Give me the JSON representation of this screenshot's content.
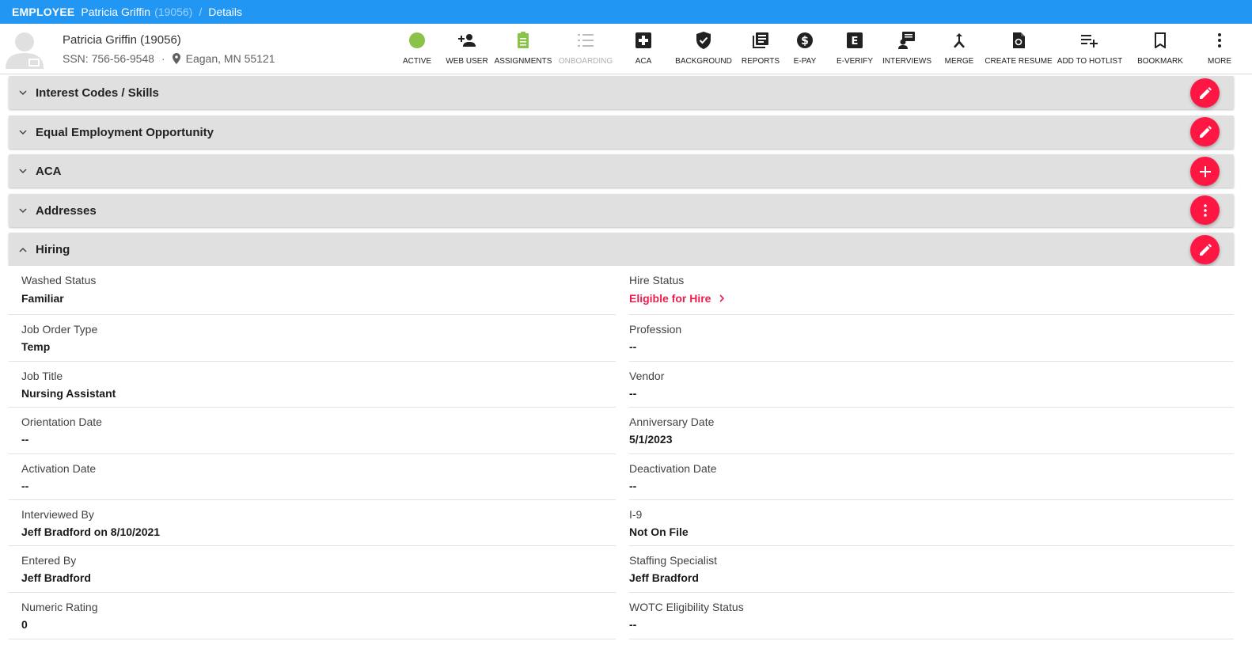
{
  "breadcrumb": {
    "module": "EMPLOYEE",
    "name": "Patricia Griffin",
    "id": "(19056)",
    "separator": "/",
    "current": "Details"
  },
  "employee": {
    "name": "Patricia Griffin (19056)",
    "ssn": "SSN: 756-56-9548",
    "dot": "·",
    "location": "Eagan, MN 55121"
  },
  "actions": [
    {
      "label": "ACTIVE",
      "icon": "active-status-dot-icon"
    },
    {
      "label": "WEB USER",
      "icon": "person-add-icon"
    },
    {
      "label": "ASSIGNMENTS",
      "icon": "clipboard-icon"
    },
    {
      "label": "ONBOARDING",
      "icon": "checklist-icon"
    },
    {
      "label": "ACA",
      "icon": "medical-plus-icon"
    },
    {
      "label": "BACKGROUND",
      "icon": "shield-check-icon"
    },
    {
      "label": "REPORTS",
      "icon": "reports-icon"
    },
    {
      "label": "E-PAY",
      "icon": "dollar-circle-icon"
    },
    {
      "label": "E-VERIFY",
      "icon": "e-verify-icon"
    },
    {
      "label": "INTERVIEWS",
      "icon": "interview-icon"
    },
    {
      "label": "MERGE",
      "icon": "merge-icon"
    },
    {
      "label": "CREATE RESUME",
      "icon": "resume-file-icon"
    },
    {
      "label": "ADD TO HOTLIST",
      "icon": "playlist-add-icon"
    },
    {
      "label": "BOOKMARK",
      "icon": "bookmark-icon"
    },
    {
      "label": "MORE",
      "icon": "more-vertical-icon"
    }
  ],
  "sections": [
    {
      "title": "Interest Codes / Skills",
      "expanded": false,
      "fab": "edit-icon"
    },
    {
      "title": "Equal Employment Opportunity",
      "expanded": false,
      "fab": "edit-icon"
    },
    {
      "title": "ACA",
      "expanded": false,
      "fab": "add-icon"
    },
    {
      "title": "Addresses",
      "expanded": false,
      "fab": "more-vertical-icon"
    },
    {
      "title": "Hiring",
      "expanded": true,
      "fab": "edit-icon"
    }
  ],
  "hiring": {
    "left": [
      {
        "label": "Washed Status",
        "value": "Familiar"
      },
      {
        "label": "Job Order Type",
        "value": "Temp"
      },
      {
        "label": "Job Title",
        "value": "Nursing Assistant"
      },
      {
        "label": "Orientation Date",
        "value": "--"
      },
      {
        "label": "Activation Date",
        "value": "--"
      },
      {
        "label": "Interviewed By",
        "value": "Jeff Bradford on 8/10/2021"
      },
      {
        "label": "Entered By",
        "value": "Jeff Bradford"
      },
      {
        "label": "Numeric Rating",
        "value": "0"
      }
    ],
    "right": [
      {
        "label": "Hire Status",
        "value": "Eligible for Hire"
      },
      {
        "label": "Profession",
        "value": "--"
      },
      {
        "label": "Vendor",
        "value": "--"
      },
      {
        "label": "Anniversary Date",
        "value": "5/1/2023"
      },
      {
        "label": "Deactivation Date",
        "value": "--"
      },
      {
        "label": "I-9",
        "value": "Not On File"
      },
      {
        "label": "Staffing Specialist",
        "value": "Jeff Bradford"
      },
      {
        "label": "WOTC Eligibility Status",
        "value": "--"
      }
    ]
  },
  "colors": {
    "topbar": "#2196f3",
    "fab": "#ff1744",
    "link": "#e91e4c",
    "active": "#8bc34a",
    "disabled": "#b0b0b0"
  }
}
